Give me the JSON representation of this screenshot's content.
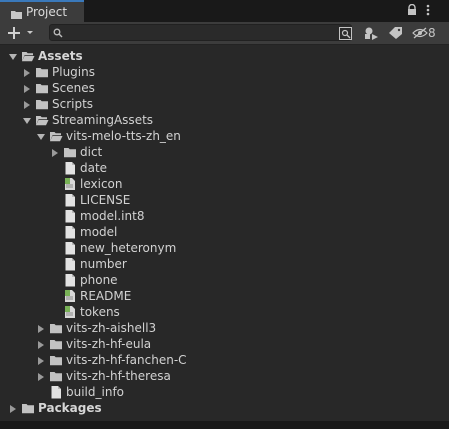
{
  "tab": {
    "title": "Project"
  },
  "toolbar": {
    "search_placeholder": "",
    "hidden_count": "8"
  },
  "tree": [
    {
      "label": "Assets",
      "depth": 0,
      "type": "folder-open",
      "arrow": "down",
      "bold": true
    },
    {
      "label": "Plugins",
      "depth": 1,
      "type": "folder",
      "arrow": "right"
    },
    {
      "label": "Scenes",
      "depth": 1,
      "type": "folder",
      "arrow": "right"
    },
    {
      "label": "Scripts",
      "depth": 1,
      "type": "folder",
      "arrow": "right"
    },
    {
      "label": "StreamingAssets",
      "depth": 1,
      "type": "folder-open",
      "arrow": "down"
    },
    {
      "label": "vits-melo-tts-zh_en",
      "depth": 2,
      "type": "folder-open",
      "arrow": "down"
    },
    {
      "label": "dict",
      "depth": 3,
      "type": "folder",
      "arrow": "right"
    },
    {
      "label": "date",
      "depth": 3,
      "type": "file"
    },
    {
      "label": "lexicon",
      "depth": 3,
      "type": "textasset"
    },
    {
      "label": "LICENSE",
      "depth": 3,
      "type": "file"
    },
    {
      "label": "model.int8",
      "depth": 3,
      "type": "file"
    },
    {
      "label": "model",
      "depth": 3,
      "type": "file"
    },
    {
      "label": "new_heteronym",
      "depth": 3,
      "type": "file"
    },
    {
      "label": "number",
      "depth": 3,
      "type": "file"
    },
    {
      "label": "phone",
      "depth": 3,
      "type": "file"
    },
    {
      "label": "README",
      "depth": 3,
      "type": "textasset"
    },
    {
      "label": "tokens",
      "depth": 3,
      "type": "textasset"
    },
    {
      "label": "vits-zh-aishell3",
      "depth": 2,
      "type": "folder",
      "arrow": "right"
    },
    {
      "label": "vits-zh-hf-eula",
      "depth": 2,
      "type": "folder",
      "arrow": "right"
    },
    {
      "label": "vits-zh-hf-fanchen-C",
      "depth": 2,
      "type": "folder",
      "arrow": "right"
    },
    {
      "label": "vits-zh-hf-theresa",
      "depth": 2,
      "type": "folder",
      "arrow": "right"
    },
    {
      "label": "build_info",
      "depth": 2,
      "type": "file"
    },
    {
      "label": "Packages",
      "depth": 0,
      "type": "folder",
      "arrow": "right",
      "bold": true
    }
  ]
}
